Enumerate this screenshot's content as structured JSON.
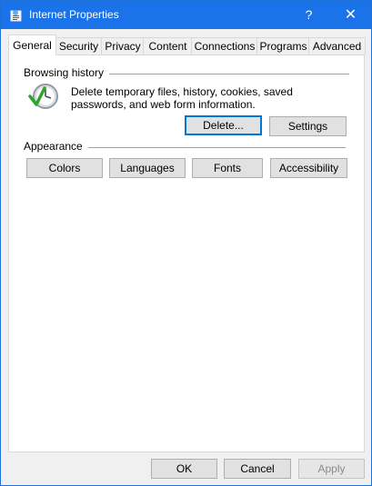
{
  "window": {
    "title": "Internet Properties",
    "help_label": "?",
    "close_label": "✕",
    "accent": "#1a73e8"
  },
  "tabs": [
    {
      "label": "General",
      "active": true
    },
    {
      "label": "Security"
    },
    {
      "label": "Privacy"
    },
    {
      "label": "Content"
    },
    {
      "label": "Connections"
    },
    {
      "label": "Programs"
    },
    {
      "label": "Advanced"
    }
  ],
  "browsing_history": {
    "heading": "Browsing history",
    "description": "Delete temporary files, history, cookies, saved passwords, and web form information.",
    "delete_label": "Delete...",
    "settings_label": "Settings",
    "icon": "history-clock-icon"
  },
  "appearance": {
    "heading": "Appearance",
    "buttons": [
      "Colors",
      "Languages",
      "Fonts",
      "Accessibility"
    ]
  },
  "footer": {
    "ok_label": "OK",
    "cancel_label": "Cancel",
    "apply_label": "Apply"
  }
}
